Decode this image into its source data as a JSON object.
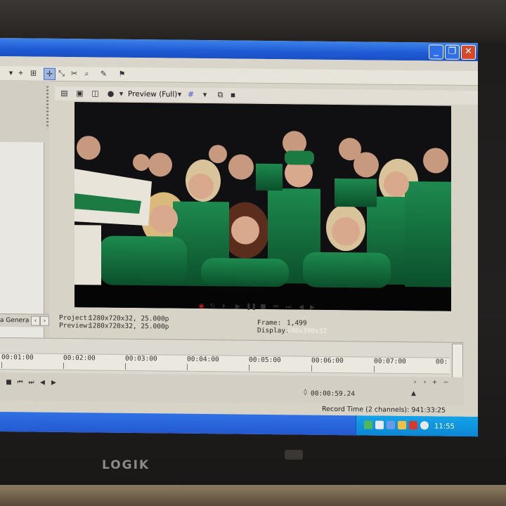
{
  "window": {
    "min_label": "_",
    "max_label": "❐",
    "close_label": "✕"
  },
  "toolbar": {
    "icons": [
      "cursor-icon",
      "snap-icon",
      "zoom-icon",
      "zoom-out-icon",
      "split-icon",
      "magnet-icon",
      "brush-icon",
      "pin-icon"
    ]
  },
  "preview": {
    "mode_label": "Preview (Full)"
  },
  "tabs": {
    "media_label": "a Genera"
  },
  "info": {
    "project_label": "Project:",
    "project_value": "1280x720x32, 25.000p",
    "preview_label": "Preview:",
    "preview_value": "1280x720x32, 25.000p",
    "frame_label": "Frame:",
    "frame_value": "1,499",
    "display_label": "Display:",
    "display_value": "698x390x32"
  },
  "timeline": {
    "ticks": [
      "00:01:00",
      "00:02:00",
      "00:03:00",
      "00:04:00",
      "00:05:00",
      "00:06:00",
      "00:07:00",
      "00:"
    ],
    "cursor_time": "00:00:59.24",
    "record_time": "Record Time (2 channels): 941:33:25"
  },
  "taskbar": {
    "clock": "11:55"
  },
  "monitor": {
    "brand": "LOGIK"
  },
  "colors": {
    "titlebar": "#1f5ad6",
    "taskbar": "#2358cf",
    "tray": "#0c84d3",
    "close": "#d9472a",
    "jersey_green": "#0e6a3a"
  }
}
